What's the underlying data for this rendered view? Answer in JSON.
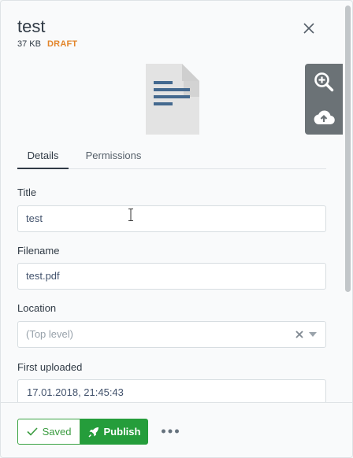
{
  "header": {
    "title": "test",
    "size": "37 KB",
    "status": "DRAFT"
  },
  "preview": {
    "tools": [
      "zoom-in-icon",
      "cloud-upload-icon"
    ]
  },
  "tabs": [
    {
      "label": "Details",
      "active": true
    },
    {
      "label": "Permissions",
      "active": false
    }
  ],
  "form": {
    "title": {
      "label": "Title",
      "value": "test"
    },
    "filename": {
      "label": "Filename",
      "value": "test.pdf"
    },
    "location": {
      "label": "Location",
      "placeholder": "(Top level)"
    },
    "first_uploaded": {
      "label": "First uploaded",
      "value": "17.01.2018, 21:45:43"
    }
  },
  "footer": {
    "saved_label": "Saved",
    "publish_label": "Publish"
  },
  "colors": {
    "accent_green": "#259d3b",
    "draft_orange": "#e3852b"
  }
}
